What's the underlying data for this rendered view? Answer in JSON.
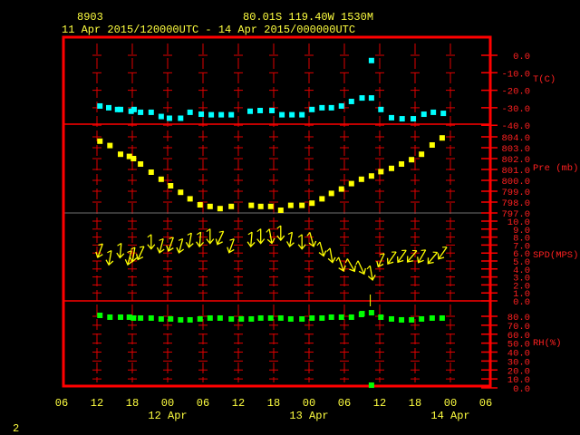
{
  "header": {
    "station": "8903",
    "location": "80.01S   119.40W   1530M",
    "time_range": "11 Apr 2015/120000UTC - 14 Apr 2015/000000UTC"
  },
  "footer": {
    "page": "2"
  },
  "colors": {
    "frame": "#ff0000",
    "temp": "#00ffff",
    "pres": "#ffff00",
    "wind": "#ffff00",
    "rh": "#00ff00",
    "text": "#ffff40",
    "axis_text": "#ff2020"
  },
  "chart_data": {
    "type": "scatter",
    "title": "8903 meteogram",
    "x": {
      "unit": "hours since 11 Apr 06UTC",
      "range": [
        0,
        72
      ],
      "tick_labels": [
        "06",
        "12",
        "18",
        "00",
        "06",
        "12",
        "18",
        "00",
        "06",
        "12",
        "18",
        "00",
        "06"
      ],
      "date_labels": [
        {
          "label": "12 Apr",
          "hour": 18
        },
        {
          "label": "13 Apr",
          "hour": 42
        },
        {
          "label": "14 Apr",
          "hour": 66
        }
      ]
    },
    "panels": [
      {
        "name": "temperature",
        "label": "T(C)",
        "ylim": [
          -40,
          0
        ],
        "ticks": [
          "0.0",
          "-10.0",
          "-20.0",
          "-30.0",
          "-40.0"
        ],
        "tick_values": [
          0,
          -10,
          -20,
          -30,
          -40
        ],
        "points": [
          [
            6.5,
            -29
          ],
          [
            8,
            -30
          ],
          [
            9.5,
            -31
          ],
          [
            10,
            -31
          ],
          [
            11.8,
            -32
          ],
          [
            12.3,
            -31
          ],
          [
            13.4,
            -32.6
          ],
          [
            15.2,
            -32.6
          ],
          [
            16.9,
            -35
          ],
          [
            18.3,
            -36
          ],
          [
            20.2,
            -36
          ],
          [
            21.8,
            -32.6
          ],
          [
            23.7,
            -33.7
          ],
          [
            25.4,
            -34
          ],
          [
            27.1,
            -34
          ],
          [
            28.8,
            -34
          ],
          [
            32,
            -32
          ],
          [
            33.7,
            -31.6
          ],
          [
            35.7,
            -31.6
          ],
          [
            37.4,
            -34
          ],
          [
            39.1,
            -34
          ],
          [
            40.8,
            -34
          ],
          [
            42.5,
            -31
          ],
          [
            44.2,
            -30
          ],
          [
            45.8,
            -30
          ],
          [
            47.5,
            -29
          ],
          [
            49.2,
            -26.4
          ],
          [
            51,
            -24.4
          ],
          [
            52.6,
            -24.4
          ],
          [
            52.6,
            -3
          ],
          [
            54.2,
            -31
          ],
          [
            56,
            -35.7
          ],
          [
            57.8,
            -36.3
          ],
          [
            59.7,
            -36.3
          ],
          [
            61.5,
            -33.7
          ],
          [
            63.1,
            -32.6
          ],
          [
            64.8,
            -33.2
          ]
        ]
      },
      {
        "name": "pressure",
        "label": "Pre (mb)",
        "ylim": [
          797,
          805
        ],
        "ticks": [
          "804.0",
          "803.0",
          "802.0",
          "801.0",
          "800.0",
          "799.0",
          "798.0",
          "797.0"
        ],
        "tick_values": [
          804,
          803,
          802,
          801,
          800,
          799,
          798,
          797
        ],
        "points": [
          [
            6.5,
            803.6
          ],
          [
            8.2,
            803.2
          ],
          [
            10,
            802.4
          ],
          [
            11.5,
            802.2
          ],
          [
            12.2,
            802
          ],
          [
            13.4,
            801.5
          ],
          [
            15.2,
            800.75
          ],
          [
            16.9,
            800.1
          ],
          [
            18.5,
            799.5
          ],
          [
            20.2,
            798.9
          ],
          [
            21.8,
            798.3
          ],
          [
            23.5,
            797.75
          ],
          [
            25.2,
            797.6
          ],
          [
            26.9,
            797.4
          ],
          [
            28.8,
            797.6
          ],
          [
            32.2,
            797.7
          ],
          [
            33.8,
            797.6
          ],
          [
            35.5,
            797.6
          ],
          [
            37.2,
            797.25
          ],
          [
            38.9,
            797.7
          ],
          [
            40.8,
            797.7
          ],
          [
            42.5,
            797.9
          ],
          [
            44.2,
            798.3
          ],
          [
            45.8,
            798.8
          ],
          [
            47.5,
            799.2
          ],
          [
            49.2,
            799.7
          ],
          [
            50.9,
            800.1
          ],
          [
            52.6,
            800.4
          ],
          [
            54.2,
            800.8
          ],
          [
            56,
            801.1
          ],
          [
            57.7,
            801.5
          ],
          [
            59.4,
            801.9
          ],
          [
            61.1,
            802.4
          ],
          [
            62.9,
            803.25
          ],
          [
            64.6,
            803.9
          ]
        ]
      },
      {
        "name": "wind_speed",
        "label": "SPD(MPS)",
        "ylim": [
          0,
          10
        ],
        "ticks": [
          "10.0",
          "9.0",
          "8.0",
          "7.0",
          "6.0",
          "5.0",
          "4.0",
          "3.0",
          "2.0",
          "1.0",
          "0.0"
        ],
        "tick_values": [
          10,
          9,
          8,
          7,
          6,
          5,
          4,
          3,
          2,
          1,
          0
        ],
        "points": [
          [
            6.5,
            6.2,
            20
          ],
          [
            8.2,
            5.3,
            10
          ],
          [
            10,
            6.2,
            5
          ],
          [
            11.5,
            5.3,
            15
          ],
          [
            12.2,
            5.7,
            10
          ],
          [
            13.4,
            5.9,
            25
          ],
          [
            15.2,
            7.3,
            0
          ],
          [
            16.9,
            6.8,
            15
          ],
          [
            18.5,
            7,
            20
          ],
          [
            20.2,
            6.8,
            15
          ],
          [
            21.8,
            7.5,
            10
          ],
          [
            23.5,
            7.6,
            5
          ],
          [
            25.2,
            8,
            0
          ],
          [
            26.9,
            7.8,
            25
          ],
          [
            28.8,
            6.8,
            20
          ],
          [
            32.2,
            7.6,
            5
          ],
          [
            33.8,
            8,
            0
          ],
          [
            35.5,
            8,
            -10
          ],
          [
            37.2,
            8.4,
            0
          ],
          [
            38.9,
            7.6,
            10
          ],
          [
            40.8,
            7.3,
            0
          ],
          [
            42.5,
            7.6,
            -15
          ],
          [
            44.2,
            6.4,
            -15
          ],
          [
            45.8,
            5.6,
            -10
          ],
          [
            47.5,
            4.5,
            -20
          ],
          [
            49.2,
            4.4,
            -30
          ],
          [
            50.9,
            4.1,
            -25
          ],
          [
            52.6,
            3.4,
            -10
          ],
          [
            54.2,
            5,
            25
          ],
          [
            56,
            5.3,
            35
          ],
          [
            57.7,
            5.5,
            35
          ],
          [
            59.4,
            5.5,
            40
          ],
          [
            61.1,
            5.5,
            30
          ],
          [
            62.9,
            5.3,
            40
          ],
          [
            64.6,
            5.9,
            35
          ]
        ]
      },
      {
        "name": "relative_humidity",
        "label": "RH(%)",
        "ylim": [
          0,
          80
        ],
        "ticks": [
          "80.0",
          "70.0",
          "60.0",
          "50.0",
          "40.0",
          "30.0",
          "20.0",
          "10.0",
          "0.0"
        ],
        "tick_values": [
          80,
          70,
          60,
          50,
          40,
          30,
          20,
          10,
          0
        ],
        "points": [
          [
            6.5,
            81
          ],
          [
            8.2,
            79
          ],
          [
            10,
            79
          ],
          [
            11.5,
            79
          ],
          [
            12.2,
            78
          ],
          [
            13.4,
            78
          ],
          [
            15.2,
            78
          ],
          [
            16.9,
            77
          ],
          [
            18.5,
            77
          ],
          [
            20.2,
            76
          ],
          [
            21.8,
            76
          ],
          [
            23.5,
            77
          ],
          [
            25.2,
            78
          ],
          [
            26.9,
            78
          ],
          [
            28.8,
            77
          ],
          [
            30.5,
            77
          ],
          [
            32.2,
            77
          ],
          [
            33.8,
            78
          ],
          [
            35.5,
            78
          ],
          [
            37.2,
            78
          ],
          [
            38.9,
            77
          ],
          [
            40.8,
            77
          ],
          [
            42.5,
            78
          ],
          [
            44.2,
            78
          ],
          [
            45.8,
            79
          ],
          [
            47.5,
            79
          ],
          [
            49.2,
            79
          ],
          [
            50.9,
            82
          ],
          [
            51,
            83
          ],
          [
            52.6,
            84
          ],
          [
            52.6,
            3
          ],
          [
            54.2,
            79
          ],
          [
            56,
            77
          ],
          [
            57.7,
            76
          ],
          [
            59.4,
            76
          ],
          [
            61.1,
            77
          ],
          [
            62.9,
            78
          ],
          [
            64.6,
            78
          ]
        ]
      }
    ]
  }
}
